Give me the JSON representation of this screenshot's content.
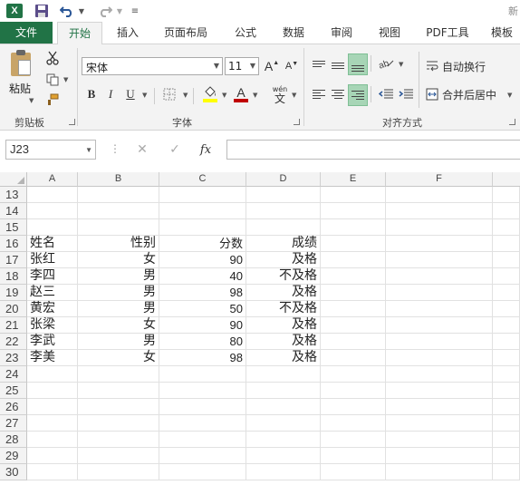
{
  "titlebar": {
    "app_icon_text": "X",
    "title_fragment": "新"
  },
  "tabs": [
    {
      "id": "file",
      "label": "文件"
    },
    {
      "id": "home",
      "label": "开始"
    },
    {
      "id": "insert",
      "label": "插入"
    },
    {
      "id": "layout",
      "label": "页面布局"
    },
    {
      "id": "formulas",
      "label": "公式"
    },
    {
      "id": "data",
      "label": "数据"
    },
    {
      "id": "review",
      "label": "审阅"
    },
    {
      "id": "view",
      "label": "视图"
    },
    {
      "id": "pdf",
      "label": "PDF工具"
    },
    {
      "id": "template",
      "label": "模板"
    }
  ],
  "ribbon": {
    "clipboard": {
      "paste_label": "粘贴",
      "group_label": "剪贴板"
    },
    "font": {
      "font_name": "宋体",
      "font_size": "11",
      "bold": "B",
      "italic": "I",
      "underline": "U",
      "grow": "A",
      "shrink": "A",
      "wen": "wén",
      "phonetic_char": "文",
      "font_color_letter": "A",
      "group_label": "字体",
      "highlight_color": "#ffff00",
      "font_color": "#c00000"
    },
    "alignment": {
      "wrap_text": "自动换行",
      "merge_center": "合并后居中",
      "group_label": "对齐方式",
      "highlight_color": "#a7d5b6"
    }
  },
  "formula_bar": {
    "name_box": "J23",
    "fx_label": "fx",
    "formula": ""
  },
  "columns": [
    "A",
    "B",
    "C",
    "D",
    "E",
    "F"
  ],
  "rows": [
    "13",
    "14",
    "15",
    "16",
    "17",
    "18",
    "19",
    "20",
    "21",
    "22",
    "23",
    "24",
    "25",
    "26",
    "27",
    "28",
    "29",
    "30"
  ],
  "table": {
    "headers": [
      "姓名",
      "性别",
      "分数",
      "成绩"
    ],
    "records": [
      [
        "张红",
        "女",
        "90",
        "及格"
      ],
      [
        "李四",
        "男",
        "40",
        "不及格"
      ],
      [
        "赵三",
        "男",
        "98",
        "及格"
      ],
      [
        "黄宏",
        "男",
        "50",
        "不及格"
      ],
      [
        "张梁",
        "女",
        "90",
        "及格"
      ],
      [
        "李武",
        "男",
        "80",
        "及格"
      ],
      [
        "李美",
        "女",
        "98",
        "及格"
      ]
    ]
  },
  "colors": {
    "accent": "#217346",
    "ribbon_bg": "#f3f3f3",
    "header_bg": "#f3f3f3"
  }
}
